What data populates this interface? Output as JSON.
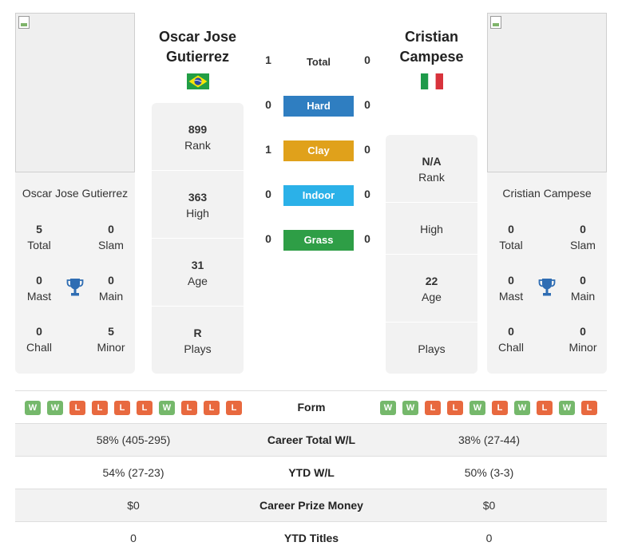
{
  "player1": {
    "name_small": "Oscar Jose Gutierrez",
    "name_line1": "Oscar Jose",
    "name_line2": "Gutierrez",
    "flag_country": "Brazil",
    "stats": {
      "total": "5",
      "total_label": "Total",
      "slam": "0",
      "slam_label": "Slam",
      "mast": "0",
      "mast_label": "Mast",
      "main": "0",
      "main_label": "Main",
      "chall": "0",
      "chall_label": "Chall",
      "minor": "5",
      "minor_label": "Minor"
    },
    "info": {
      "rank": "899",
      "rank_label": "Rank",
      "high": "363",
      "high_label": "High",
      "age": "31",
      "age_label": "Age",
      "plays": "R",
      "plays_label": "Plays"
    },
    "form": [
      "W",
      "W",
      "L",
      "L",
      "L",
      "L",
      "W",
      "L",
      "L",
      "L"
    ]
  },
  "player2": {
    "name_small": "Cristian Campese",
    "name_line1": "Cristian",
    "name_line2": "Campese",
    "flag_country": "Italy",
    "stats": {
      "total": "0",
      "total_label": "Total",
      "slam": "0",
      "slam_label": "Slam",
      "mast": "0",
      "mast_label": "Mast",
      "main": "0",
      "main_label": "Main",
      "chall": "0",
      "chall_label": "Chall",
      "minor": "0",
      "minor_label": "Minor"
    },
    "info": {
      "rank": "N/A",
      "rank_label": "Rank",
      "high": "",
      "high_label": "High",
      "age": "22",
      "age_label": "Age",
      "plays": "",
      "plays_label": "Plays"
    },
    "form": [
      "W",
      "W",
      "L",
      "L",
      "W",
      "L",
      "W",
      "L",
      "W",
      "L"
    ]
  },
  "h2h": {
    "total": {
      "label": "Total",
      "p1": "1",
      "p2": "0"
    },
    "hard": {
      "label": "Hard",
      "p1": "0",
      "p2": "0",
      "color": "#2f7ec1"
    },
    "clay": {
      "label": "Clay",
      "p1": "1",
      "p2": "0",
      "color": "#e0a11b"
    },
    "indoor": {
      "label": "Indoor",
      "p1": "0",
      "p2": "0",
      "color": "#2bb1e8"
    },
    "grass": {
      "label": "Grass",
      "p1": "0",
      "p2": "0",
      "color": "#2e9e46"
    }
  },
  "comparison": {
    "form_label": "Form",
    "rows": [
      {
        "label": "Career Total W/L",
        "p1": "58% (405-295)",
        "p2": "38% (27-44)"
      },
      {
        "label": "YTD W/L",
        "p1": "54% (27-23)",
        "p2": "50% (3-3)"
      },
      {
        "label": "Career Prize Money",
        "p1": "$0",
        "p2": "$0"
      },
      {
        "label": "YTD Titles",
        "p1": "0",
        "p2": "0"
      }
    ]
  },
  "colors": {
    "win": "#75b86b",
    "loss": "#e8693f",
    "trophy": "#2f6db3"
  }
}
